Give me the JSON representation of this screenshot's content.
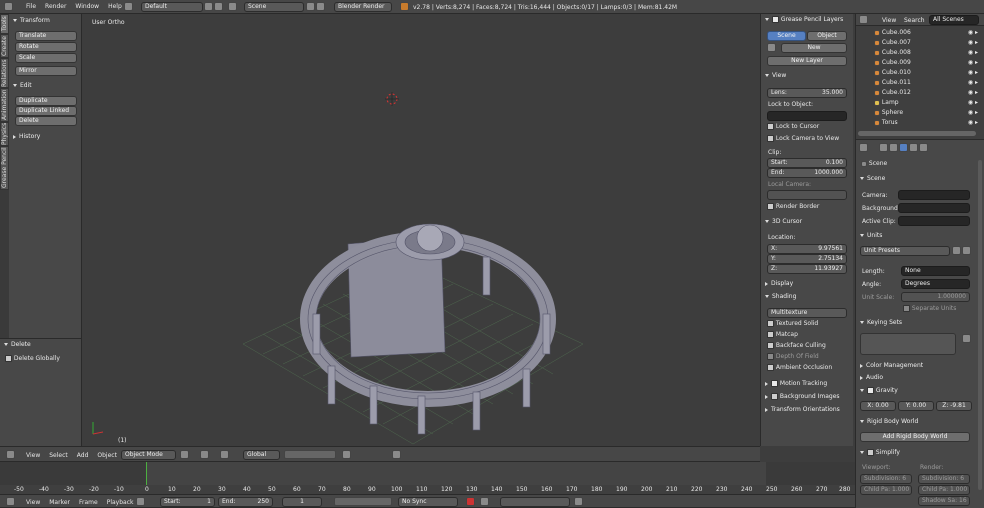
{
  "topbar": {
    "menus": [
      "File",
      "Render",
      "Window",
      "Help"
    ],
    "layout": "Default",
    "scene": "Scene",
    "engine": "Blender Render",
    "stats": "v2.78 | Verts:8,274 | Faces:8,724 | Tris:16,444 | Objects:0/17 | Lamps:0/3 | Mem:81.42M"
  },
  "toolshelf": {
    "tabs": [
      "Tools",
      "Create",
      "Relations",
      "Animation",
      "Physics",
      "Grease Pencil"
    ],
    "transform_header": "Transform",
    "transform_buttons": [
      "Translate",
      "Rotate",
      "Scale"
    ],
    "mirror": "Mirror",
    "edit_header": "Edit",
    "edit_buttons": [
      "Duplicate",
      "Duplicate Linked",
      "Delete"
    ],
    "history": "History",
    "op_header": "Delete",
    "op_option": "Delete Globally"
  },
  "viewport": {
    "label": "User Ortho",
    "frame": "(1)",
    "colors": {
      "bg": "#3d3d3d",
      "mesh": "#9090a0",
      "grid": "#5a8a5a"
    }
  },
  "viewheader": {
    "menus": [
      "View",
      "Select",
      "Add",
      "Object"
    ],
    "mode": "Object Mode",
    "orientation": "Global"
  },
  "timeline": {
    "ticks": [
      "-50",
      "-40",
      "-30",
      "-20",
      "-10",
      "0",
      "10",
      "20",
      "30",
      "40",
      "50",
      "60",
      "70",
      "80",
      "90",
      "100",
      "110",
      "120",
      "130",
      "140",
      "150",
      "160",
      "170",
      "180",
      "190",
      "200",
      "210",
      "220",
      "230",
      "240",
      "250",
      "260",
      "270",
      "280"
    ],
    "menus": [
      "View",
      "Marker",
      "Frame",
      "Playback"
    ],
    "start_label": "Start:",
    "start": "1",
    "end_label": "End:",
    "end": "250",
    "current": "1",
    "sync": "No Sync"
  },
  "npanel": {
    "gp_header": "Grease Pencil Layers",
    "scene_tab": "Scene",
    "object_tab": "Object",
    "new": "New",
    "new_layer": "New Layer",
    "view_header": "View",
    "lens_label": "Lens:",
    "lens": "35.000",
    "lock_object": "Lock to Object:",
    "lock_cursor": "Lock to Cursor",
    "lock_camera": "Lock Camera to View",
    "clip": "Clip:",
    "start_label": "Start:",
    "start": "0.100",
    "end_label": "End:",
    "end": "1000.000",
    "local_camera": "Local Camera:",
    "render_border": "Render Border",
    "cursor_header": "3D Cursor",
    "location": "Location:",
    "x_label": "X:",
    "x": "9.97561",
    "y_label": "Y:",
    "y": "2.75134",
    "z_label": "Z:",
    "z": "11.93927",
    "display": "Display",
    "shading": "Shading",
    "shading_mode": "Multitexture",
    "shading_opts": [
      "Textured Solid",
      "Matcap",
      "Backface Culling",
      "Depth Of Field",
      "Ambient Occlusion"
    ],
    "motion_tracking": "Motion Tracking",
    "background_images": "Background Images",
    "transform_orient": "Transform Orientations"
  },
  "outliner": {
    "menus": [
      "View",
      "Search",
      "All Scenes"
    ],
    "items": [
      "Cube.006",
      "Cube.007",
      "Cube.008",
      "Cube.009",
      "Cube.010",
      "Cube.011",
      "Cube.012",
      "Lamp",
      "Sphere",
      "Torus"
    ]
  },
  "properties": {
    "scene_item": "Scene",
    "scene_header": "Scene",
    "camera": "Camera:",
    "background": "Background:",
    "active_clip": "Active Clip:",
    "units": "Units",
    "unit_presets": "Unit Presets",
    "length_label": "Length:",
    "length": "None",
    "angle_label": "Angle:",
    "angle": "Degrees",
    "unit_scale_label": "Unit Scale:",
    "unit_scale": "1.000000",
    "separate_units": "Separate Units",
    "keying_sets": "Keying Sets",
    "color_mgmt": "Color Management",
    "audio": "Audio",
    "gravity": "Gravity",
    "gx": "X: 0.00",
    "gy": "Y: 0.00",
    "gz": "Z: -9.81",
    "rigid": "Rigid Body World",
    "add_rigid": "Add Rigid Body World",
    "simplify": "Simplify",
    "viewport_lbl": "Viewport:",
    "render_lbl": "Render:",
    "subdiv_l": "Subdivision: 6",
    "subdiv_r": "Subdivision: 6",
    "child_l": "Child Pa: 1.000",
    "child_r": "Child Pa: 1.000",
    "shadow": "Shadow Sa: 16"
  }
}
